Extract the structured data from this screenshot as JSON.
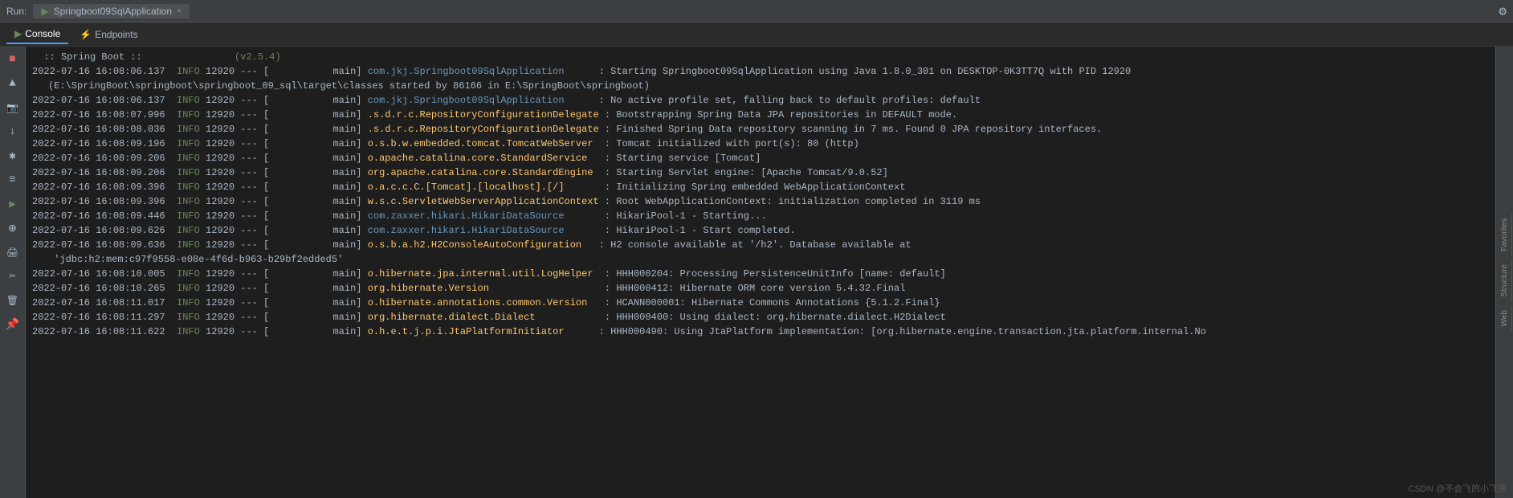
{
  "topbar": {
    "run_label": "Run:",
    "tab_label": "Springboot09SqlApplication",
    "tab_close": "×",
    "settings_icon": "⚙"
  },
  "toolbar": {
    "console_label": "Console",
    "console_icon": "▶",
    "endpoints_label": "Endpoints",
    "endpoints_icon": "⚡"
  },
  "sidebar_buttons": [
    {
      "icon": "■",
      "class": "red",
      "name": "stop"
    },
    {
      "icon": "▲",
      "class": "",
      "name": "up"
    },
    {
      "icon": "📷",
      "class": "",
      "name": "screenshot"
    },
    {
      "icon": "↓",
      "class": "",
      "name": "down"
    },
    {
      "icon": "✱",
      "class": "",
      "name": "star"
    },
    {
      "icon": "≡",
      "class": "",
      "name": "menu"
    },
    {
      "icon": "▶",
      "class": "green",
      "name": "play"
    },
    {
      "icon": "⊕",
      "class": "",
      "name": "add"
    },
    {
      "icon": "🖨",
      "class": "",
      "name": "print"
    },
    {
      "icon": "✂",
      "class": "",
      "name": "cut"
    },
    {
      "icon": "🗑",
      "class": "",
      "name": "trash"
    },
    {
      "icon": "📌",
      "class": "",
      "name": "pin"
    }
  ],
  "log_lines": [
    {
      "type": "banner",
      "content": "  :: Spring Boot ::                (v2.5.4)"
    },
    {
      "timestamp": "2022-07-16 16:08:06.137",
      "level": "INFO",
      "pid": "12920",
      "sep": "---",
      "thread": "[",
      "thread_name": "           main]",
      "logger": "com.jkj.Springboot09SqlApplication",
      "logger_class": "spring",
      "message": " : Starting Springboot09SqlApplication using Java 1.8.0_301 on DESKTOP-0K3TT7Q with PID 12920"
    },
    {
      "type": "continuation",
      "content": " (E:\\SpringBoot\\springboot\\springboot_09_sql\\target\\classes started by 86166 in E:\\SpringBoot\\springboot)"
    },
    {
      "timestamp": "2022-07-16 16:08:06.137",
      "level": "INFO",
      "pid": "12920",
      "sep": "---",
      "thread_name": "           main]",
      "logger": "com.jkj.Springboot09SqlApplication",
      "logger_class": "spring",
      "message": " : No active profile set, falling back to default profiles: default"
    },
    {
      "timestamp": "2022-07-16 16:08:07.996",
      "level": "INFO",
      "pid": "12920",
      "sep": "---",
      "thread_name": "           main]",
      "logger": ".s.d.r.c.RepositoryConfigurationDelegate",
      "logger_class": "highlight",
      "message": " : Bootstrapping Spring Data JPA repositories in DEFAULT mode."
    },
    {
      "timestamp": "2022-07-16 16:08:08.036",
      "level": "INFO",
      "pid": "12920",
      "sep": "---",
      "thread_name": "           main]",
      "logger": ".s.d.r.c.RepositoryConfigurationDelegate",
      "logger_class": "highlight",
      "message": " : Finished Spring Data repository scanning in 7 ms. Found 0 JPA repository interfaces."
    },
    {
      "timestamp": "2022-07-16 16:08:09.196",
      "level": "INFO",
      "pid": "12920",
      "sep": "---",
      "thread_name": "           main]",
      "logger": "o.s.b.w.embedded.tomcat.TomcatWebServer",
      "logger_class": "highlight",
      "message": " : Tomcat initialized with port(s): 80 (http)"
    },
    {
      "timestamp": "2022-07-16 16:08:09.206",
      "level": "INFO",
      "pid": "12920",
      "sep": "---",
      "thread_name": "           main]",
      "logger": "o.apache.catalina.core.StandardService",
      "logger_class": "highlight",
      "message": " : Starting service [Tomcat]"
    },
    {
      "timestamp": "2022-07-16 16:08:09.206",
      "level": "INFO",
      "pid": "12920",
      "sep": "---",
      "thread_name": "           main]",
      "logger": "org.apache.catalina.core.StandardEngine",
      "logger_class": "highlight",
      "message": " : Starting Servlet engine: [Apache Tomcat/9.0.52]"
    },
    {
      "timestamp": "2022-07-16 16:08:09.396",
      "level": "INFO",
      "pid": "12920",
      "sep": "---",
      "thread_name": "           main]",
      "logger": "o.a.c.c.C.[Tomcat].[localhost].[/]",
      "logger_class": "highlight",
      "message": " : Initializing Spring embedded WebApplicationContext"
    },
    {
      "timestamp": "2022-07-16 16:08:09.396",
      "level": "INFO",
      "pid": "12920",
      "sep": "---",
      "thread_name": "           main]",
      "logger": "w.s.c.ServletWebServerApplicationContext",
      "logger_class": "highlight",
      "message": " : Root WebApplicationContext: initialization completed in 3119 ms"
    },
    {
      "timestamp": "2022-07-16 16:08:09.446",
      "level": "INFO",
      "pid": "12920",
      "sep": "---",
      "thread_name": "           main]",
      "logger": "com.zaxxer.hikari.HikariDataSource",
      "logger_class": "spring",
      "message": " : HikariPool-1 - Starting..."
    },
    {
      "timestamp": "2022-07-16 16:08:09.626",
      "level": "INFO",
      "pid": "12920",
      "sep": "---",
      "thread_name": "           main]",
      "logger": "com.zaxxer.hikari.HikariDataSource",
      "logger_class": "spring",
      "message": " : HikariPool-1 - Start completed."
    },
    {
      "timestamp": "2022-07-16 16:08:09.636",
      "level": "INFO",
      "pid": "12920",
      "sep": "---",
      "thread_name": "           main]",
      "logger": "o.s.b.a.h2.H2ConsoleAutoConfiguration",
      "logger_class": "highlight",
      "message": " : H2 console available at '/h2'. Database available at"
    },
    {
      "type": "continuation",
      "content": " 'jdbc:h2:mem:c97f9558-e08e-4f6d-b963-b29bf2edded5'"
    },
    {
      "timestamp": "2022-07-16 16:08:10.005",
      "level": "INFO",
      "pid": "12920",
      "sep": "---",
      "thread_name": "           main]",
      "logger": "o.hibernate.jpa.internal.util.LogHelper",
      "logger_class": "highlight",
      "message": " : HHH000204: Processing PersistenceUnitInfo [name: default]"
    },
    {
      "timestamp": "2022-07-16 16:08:10.265",
      "level": "INFO",
      "pid": "12920",
      "sep": "---",
      "thread_name": "           main]",
      "logger": "org.hibernate.Version",
      "logger_class": "highlight",
      "message": " : HHH000412: Hibernate ORM core version 5.4.32.Final"
    },
    {
      "timestamp": "2022-07-16 16:08:11.017",
      "level": "INFO",
      "pid": "12920",
      "sep": "---",
      "thread_name": "           main]",
      "logger": "o.hibernate.annotations.common.Version",
      "logger_class": "highlight",
      "message": " : HCANN000001: Hibernate Commons Annotations {5.1.2.Final}"
    },
    {
      "timestamp": "2022-07-16 16:08:11.297",
      "level": "INFO",
      "pid": "12920",
      "sep": "---",
      "thread_name": "           main]",
      "logger": "org.hibernate.dialect.Dialect",
      "logger_class": "highlight",
      "message": " : HHH000400: Using dialect: org.hibernate.dialect.H2Dialect"
    },
    {
      "timestamp": "2022-07-16 16:08:11.622",
      "level": "INFO",
      "pid": "12920",
      "sep": "---",
      "thread_name": "           main]",
      "logger": "o.h.e.t.j.p.i.JtaPlatformInitiator",
      "logger_class": "highlight",
      "message": " : HHH000490: Using JtaPlatform implementation: [org.hibernate.engine.transaction.jta.platform.internal.No"
    }
  ],
  "watermark": "CSDN @不会飞的小飞侠",
  "right_tabs": [
    "Favorites",
    "Structure",
    "Web"
  ]
}
